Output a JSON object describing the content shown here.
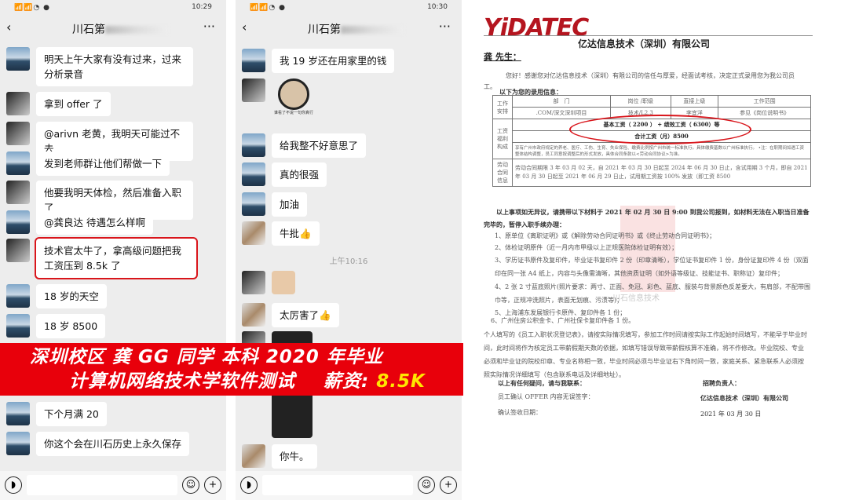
{
  "left_chat": {
    "status_time": "10:29",
    "title": "川石第",
    "messages": [
      "明天上午大家有没有过来，过来分析录音",
      "拿到 offer 了",
      "@arivn 老黄，我明天可能过不去",
      "发到老师群让他们帮做一下",
      "他要我明天体检，然后准备入职了",
      "@龚良达 待遇怎么样啊",
      "技术官太牛了，拿高级问题把我工资压到 8.5k 了",
      "18 岁的天空",
      "18 岁 8500",
      "下个月满 20",
      "你这个会在川石历史上永久保存"
    ]
  },
  "right_chat": {
    "status_time": "10:30",
    "title": "川石第",
    "messages": [
      "我 19 岁还在用家里的钱",
      "给我整不好意思了",
      "真的很强",
      "加油",
      "牛批👍",
      "太厉害了👍",
      "你牛。"
    ],
    "sticker_caption": "谁看了不说一句你真行",
    "timestamp": "上午10:16"
  },
  "banner": {
    "line1": "深圳校区 龚 GG 同学 本科 2020 年毕业",
    "line2": "计算机网络技术学软件测试",
    "salary_label": "薪资:",
    "salary": "8.5K"
  },
  "doc": {
    "logo": "YiDATEC",
    "company": "亿达信息技术（深圳）有限公司",
    "greeting": "龚    先生：",
    "intro": "您好！感谢您对亿达信息技术（深圳）有限公司的信任与厚爱，经面试考核，决定正式录用您为我公司员工。",
    "info_title": "以下为您的录用信息：",
    "table": {
      "work": "工作安排",
      "headers": [
        "部　门",
        "岗位 /职级",
        "直接上级",
        "工作范围"
      ],
      "row": [
        ".COM/深文深圳项目",
        "技术/L2.3",
        "李宜洋",
        "参见《岗位说明书》"
      ],
      "pay": "工资福利构成",
      "base": "基本工资（ 2200 ） + 绩效工资（ 6300）等",
      "total": "合计工资（月）8500",
      "pay_note": "享有广州市政府规定的养老、医疗、工伤、生育、失业保险、缴费比例按广州市统一标准执行。具体缴费基数以广州标准执行。 •注：在职期间如遇工资整体结构调整，员工同意按调整后的形式发放，具体合同条款以<劳动合同协议>为准。",
      "contract": "劳动合同信息",
      "contract_text": "劳动合同期限 3 年 03 月 02 天，自 2021 年 03 月 30 日起至 2024 年 06 月 30 日止，含试用期 3 个月，即自 2021 年 03 月 30 日起至 2021 年 06 月 29 日止，试用期工资按 100% 发放（即工资 8500"
    },
    "report": "以上事项如无异议，请携带以下材料于 2021 年 02 月 30 日 9:00 到我公司报到，如材料无法在入职当日准备完毕的，暂停入职手续办理：",
    "items": [
      "1、原单位《离职证明》或《解除劳动合同证明书》或《终止劳动合同证明书》；",
      "2、体检证明原件（近一月内市甲级以上正规医院体检证明有效）；",
      "3、学历证书原件及复印件，毕业证书复印件 2 份（印章清晰），学位证书复印件 1 份，身份证复印件 4 份（双面印在同一张 A4 纸上，内容与头像需清晰，其他资质证明（如外语等级证、技能证书、职称证）复印件；",
      "4、2 张 2 寸蓝底照片(照片要求：两寸、正面、免冠、彩色、蓝底、服装与背景颜色反差要大，有肩部，不配带围巾等，正规冲洗照片，表面无划痕、污渍等)；",
      "5、上海浦东发展银行卡原件、复印件各 1 份；",
      "6、广州住房公积金卡、广州社保卡复印件各 1 份。"
    ],
    "notes": "个人填写的《员工入职状况登记表》，请按实际情况填写，参加工作时间请按实际工作起始时间填写，不能早于毕业时间，此时间将作为核定员工带薪假期天数的依据，如填写错误导致带薪假核算不准确，将不作修改。毕业院校、专业必须和毕业证的院校印章、专业名称相一致，毕业时间必须与毕业证右下角时间一致，家庭关系、紧急联系人必须按照实际情况详细填写（包含联系电话及详细地址）。",
    "contact": "以上有任何疑问，请与我联系：",
    "recruiter": "招聘负责人：",
    "confirm": "员工确认 OFFER 内容无误签字：",
    "signer": "亿达信息技术（深圳）有限公司",
    "confirm_date": "确认签收日期：",
    "date": "2021 年 03 月 30 日",
    "watermark": "川石信息技术"
  }
}
